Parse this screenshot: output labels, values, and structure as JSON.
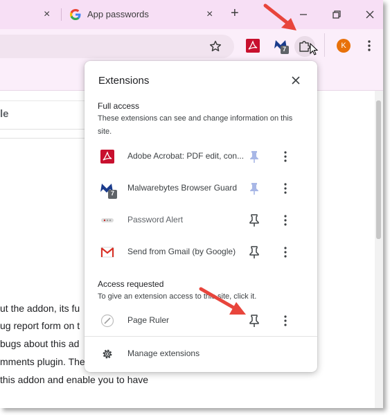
{
  "browser": {
    "prev_tab_close": "×",
    "active_tab": {
      "title": "App passwords",
      "close": "×"
    },
    "new_tab": "+",
    "window_buttons": {
      "minimize": "–",
      "maximize": "❐",
      "close": "✕"
    }
  },
  "toolbar": {
    "bookmark_icon": "star-icon",
    "extension_badge": "7",
    "profile_initial": "K",
    "profile_color": "#e8710a",
    "menu_icon": "kebab-menu-icon"
  },
  "page": {
    "search_fragment": "le",
    "body_lines": [
      "ut the addon, its fu",
      "ug report form on t",
      "bugs about this ad",
      "mments plugin. The",
      "this addon and enable you to have"
    ]
  },
  "popup": {
    "title": "Extensions",
    "full_access": {
      "heading": "Full access",
      "description": "These extensions can see and change information on this site.",
      "items": [
        {
          "name": "Adobe Acrobat: PDF edit, con...",
          "icon": "adobe-acrobat-icon",
          "pinned": true
        },
        {
          "name": "Malwarebytes Browser Guard",
          "icon": "malwarebytes-icon",
          "badge": "7",
          "pinned": true
        },
        {
          "name": "Password Alert",
          "icon": "password-alert-icon",
          "pinned": false
        },
        {
          "name": "Send from Gmail (by Google)",
          "icon": "gmail-icon",
          "pinned": false
        }
      ]
    },
    "access_requested": {
      "heading": "Access requested",
      "description": "To give an extension access to this site, click it.",
      "items": [
        {
          "name": "Page Ruler",
          "icon": "page-ruler-icon",
          "pinned": false
        }
      ]
    },
    "manage_label": "Manage extensions"
  },
  "colors": {
    "tab_strip": "#f7dff5",
    "toolbar": "#fbeefa",
    "annotation_arrow": "#e8453c",
    "pin_active": "#a8b7e6",
    "acrobat_red": "#c8102e"
  }
}
